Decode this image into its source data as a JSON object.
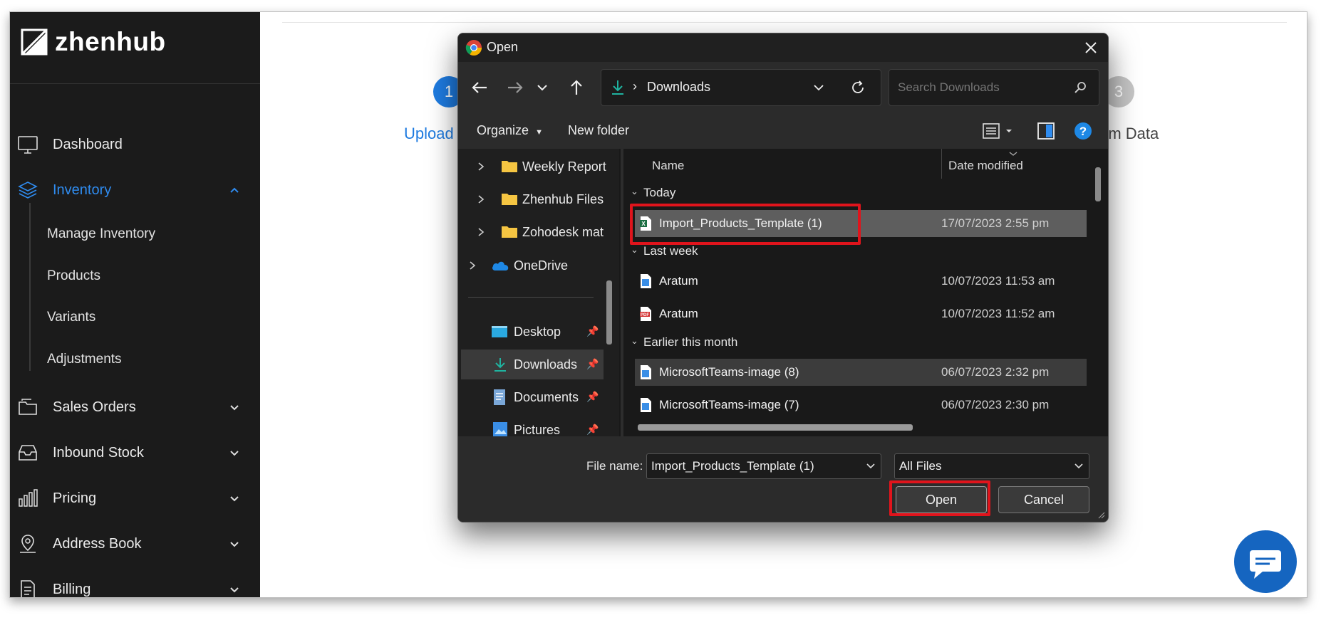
{
  "app": {
    "brand": "zhenhub"
  },
  "sidebar": {
    "items": [
      {
        "label": "Dashboard",
        "icon": "monitor-icon"
      },
      {
        "label": "Inventory",
        "icon": "layers-icon",
        "active": true
      },
      {
        "label": "Sales Orders",
        "icon": "folder-icon"
      },
      {
        "label": "Inbound Stock",
        "icon": "inbox-icon"
      },
      {
        "label": "Pricing",
        "icon": "bar-chart-icon"
      },
      {
        "label": "Address Book",
        "icon": "map-pin-icon"
      },
      {
        "label": "Billing",
        "icon": "document-list-icon"
      }
    ],
    "inventory_sub": [
      "Manage Inventory",
      "Products",
      "Variants",
      "Adjustments"
    ],
    "active_color": "#2f8cf0"
  },
  "page": {
    "step1": {
      "number": "1",
      "label": "Upload"
    },
    "step3": {
      "number": "3",
      "label": "rm Data"
    }
  },
  "dialog": {
    "title": "Open",
    "address": {
      "separator": "›",
      "location": "Downloads"
    },
    "search": {
      "placeholder": "Search Downloads"
    },
    "commands": {
      "organize": "Organize",
      "new_folder": "New folder"
    },
    "tree": [
      {
        "label": "Weekly Report",
        "type": "folder"
      },
      {
        "label": "Zhenhub Files",
        "type": "folder"
      },
      {
        "label": "Zohodesk mat",
        "type": "folder"
      },
      {
        "label": "OneDrive",
        "type": "cloud"
      },
      {
        "label": "Desktop",
        "type": "pinned"
      },
      {
        "label": "Downloads",
        "type": "pinned",
        "selected": true
      },
      {
        "label": "Documents",
        "type": "pinned"
      },
      {
        "label": "Pictures",
        "type": "pinned"
      }
    ],
    "columns": {
      "name": "Name",
      "date": "Date modified"
    },
    "groups": {
      "today": {
        "label": "Today",
        "files": [
          {
            "name": "Import_Products_Template (1)",
            "date": "17/07/2023 2:55 pm",
            "type": "excel"
          }
        ]
      },
      "last_week": {
        "label": "Last week",
        "files": [
          {
            "name": "Aratum",
            "date": "10/07/2023 11:53 am",
            "type": "image"
          },
          {
            "name": "Aratum",
            "date": "10/07/2023 11:52 am",
            "type": "pdf"
          }
        ]
      },
      "earlier": {
        "label": "Earlier this month",
        "files": [
          {
            "name": "MicrosoftTeams-image (8)",
            "date": "06/07/2023 2:32 pm",
            "type": "image"
          },
          {
            "name": "MicrosoftTeams-image (7)",
            "date": "06/07/2023 2:30 pm",
            "type": "image"
          }
        ]
      }
    },
    "footer": {
      "file_name_label": "File name:",
      "file_name_value": "Import_Products_Template (1)",
      "file_type": "All Files",
      "open": "Open",
      "cancel": "Cancel"
    },
    "highlight_color": "#e0141c"
  }
}
